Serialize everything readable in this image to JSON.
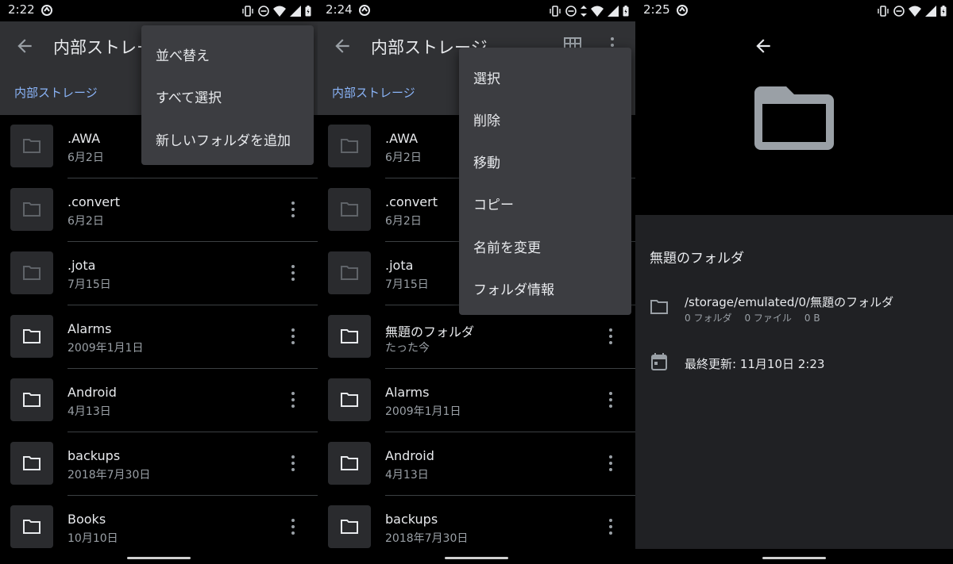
{
  "colors": {
    "accent": "#8ab4f8",
    "appbar": "#303134",
    "menu": "#3c3d41",
    "detailsBg": "#202124"
  },
  "panel1": {
    "status_time": "2:22",
    "title": "内部ストレージ",
    "breadcrumb": "内部ストレージ",
    "files": [
      {
        "name": ".AWA",
        "date": "6月2日"
      },
      {
        "name": ".convert",
        "date": "6月2日"
      },
      {
        "name": ".jota",
        "date": "7月15日"
      },
      {
        "name": "Alarms",
        "date": "2009年1月1日"
      },
      {
        "name": "Android",
        "date": "4月13日"
      },
      {
        "name": "backups",
        "date": "2018年7月30日"
      },
      {
        "name": "Books",
        "date": "10月10日"
      }
    ],
    "menu": [
      "並べ替え",
      "すべて選択",
      "新しいフォルダを追加"
    ]
  },
  "panel2": {
    "status_time": "2:24",
    "title": "内部ストレージ",
    "breadcrumb": "内部ストレージ",
    "files": [
      {
        "name": ".AWA",
        "date": "6月2日"
      },
      {
        "name": ".convert",
        "date": "6月2日"
      },
      {
        "name": ".jota",
        "date": "7月15日"
      },
      {
        "name": "無題のフォルダ",
        "date": "たった今"
      },
      {
        "name": "Alarms",
        "date": "2009年1月1日"
      },
      {
        "name": "Android",
        "date": "4月13日"
      },
      {
        "name": "backups",
        "date": "2018年7月30日"
      }
    ],
    "menu": [
      "選択",
      "削除",
      "移動",
      "コピー",
      "名前を変更",
      "フォルダ情報"
    ]
  },
  "panel3": {
    "status_time": "2:25",
    "folder_name": "無題のフォルダ",
    "path": "/storage/emulated/0/無題のフォルダ",
    "folder_count": "0 フォルダ",
    "file_count": "0 ファイル",
    "size": "0 B",
    "modified": "最終更新: 11月10日 2:23"
  }
}
